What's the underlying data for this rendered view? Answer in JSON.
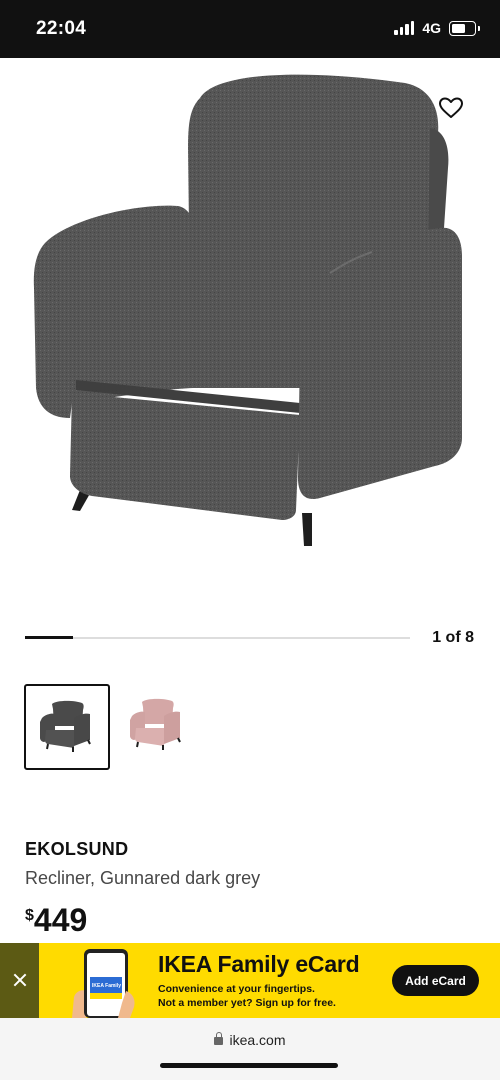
{
  "status_bar": {
    "time": "22:04",
    "network": "4G"
  },
  "gallery": {
    "counter": "1 of 8",
    "progress": 0.125
  },
  "swatches": [
    {
      "name": "Gunnared dark grey",
      "color": "#4a4a4a",
      "selected": true
    },
    {
      "name": "pink",
      "color": "#d4a7a6",
      "selected": false
    }
  ],
  "product": {
    "name": "EKOLSUND",
    "description": "Recliner, Gunnared dark grey",
    "currency": "$",
    "price": "449"
  },
  "banner": {
    "title": "IKEA Family eCard",
    "line1": "Convenience at your fingertips.",
    "line2": "Not a member yet? Sign up for free.",
    "button": "Add eCard",
    "phone_label": "IKEA Family"
  },
  "browser": {
    "url": "ikea.com"
  },
  "colors": {
    "banner_bg": "#ffdb00",
    "banner_close_bg": "#5c5a14",
    "fabric": "#555555"
  }
}
